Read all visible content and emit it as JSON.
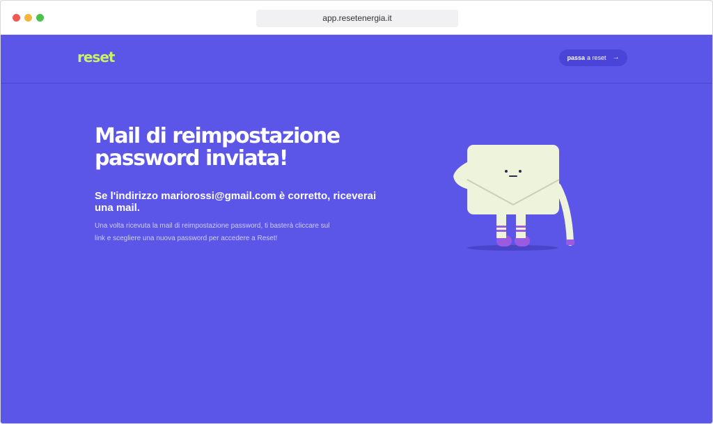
{
  "browser": {
    "url": "app.resetenergia.it"
  },
  "header": {
    "logo": "reset",
    "cta_strong": "passa",
    "cta_rest": "a reset",
    "cta_arrow": "→"
  },
  "main": {
    "title_line1": "Mail di reimpostazione",
    "title_line2": "password inviata!",
    "subtitle_line1": "Se l'indirizzo mariorossi@gmail.com è corretto, riceverai",
    "subtitle_line2": "una mail.",
    "body_line1": "Una volta ricevuta la mail di reimpostazione password, ti basterà cliccare sul",
    "body_line2": "link e scegliere una nuova password per accedere a Reset!"
  },
  "colors": {
    "background": "#5b55e8",
    "logo": "#c7f36a",
    "envelope": "#eef3dc",
    "accent": "#9a5be0"
  }
}
